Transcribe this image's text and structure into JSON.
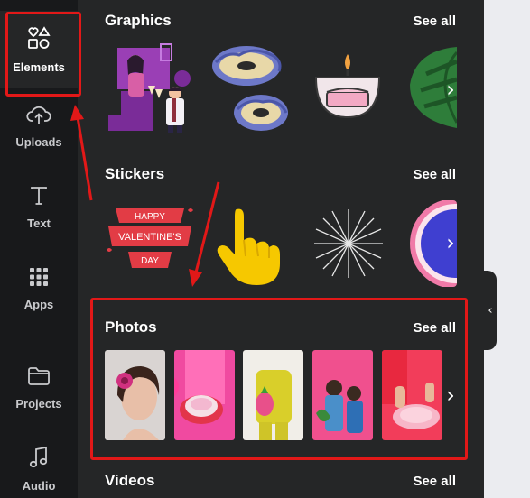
{
  "rail": {
    "items": [
      {
        "label": "Elements",
        "icon": "elements-icon"
      },
      {
        "label": "Uploads",
        "icon": "cloud-upload-icon"
      },
      {
        "label": "Text",
        "icon": "text-icon"
      },
      {
        "label": "Apps",
        "icon": "apps-grid-icon"
      },
      {
        "label": "Projects",
        "icon": "folder-icon"
      },
      {
        "label": "Audio",
        "icon": "music-note-icon"
      }
    ]
  },
  "sections": {
    "graphics": {
      "title": "Graphics",
      "see_all": "See all"
    },
    "stickers": {
      "title": "Stickers",
      "see_all": "See all"
    },
    "photos": {
      "title": "Photos",
      "see_all": "See all"
    },
    "videos": {
      "title": "Videos",
      "see_all": "See all"
    }
  },
  "stickers": {
    "valentine_lines": [
      "HAPPY",
      "VALENTINE'S",
      "DAY"
    ]
  },
  "colors": {
    "panel": "#252627",
    "rail": "#18191b",
    "annotation": "#e21818"
  }
}
